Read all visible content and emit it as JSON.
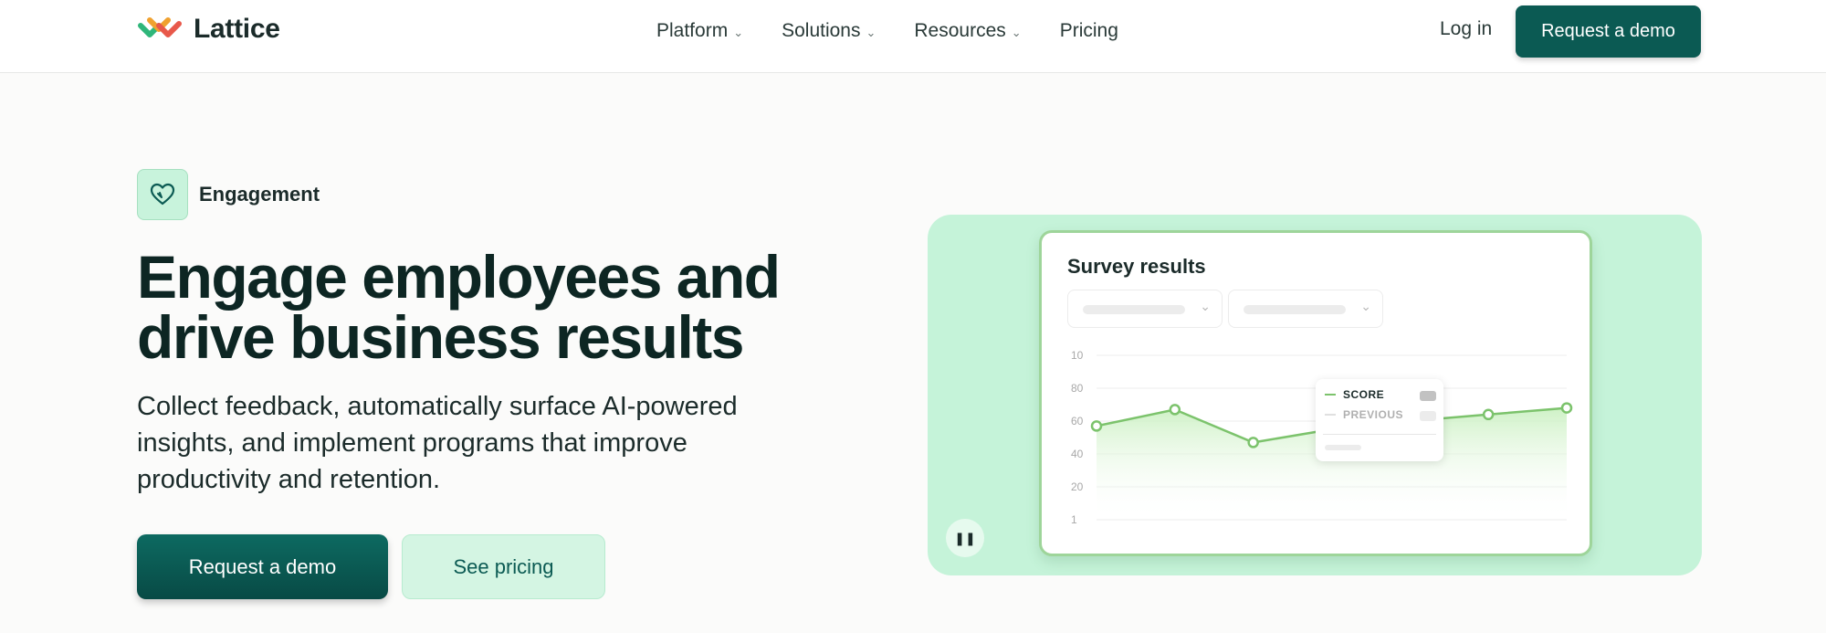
{
  "nav": {
    "brand": "Lattice",
    "links": [
      {
        "label": "Platform",
        "chevron": "⌄"
      },
      {
        "label": "Solutions",
        "chevron": "⌄"
      },
      {
        "label": "Resources",
        "chevron": "⌄"
      },
      {
        "label": "Pricing",
        "chevron": ""
      }
    ],
    "login": "Log in",
    "cta": "Request a demo"
  },
  "hero": {
    "badge": "Engagement",
    "title": "Engage employees and drive business results",
    "subtitle": "Collect feedback, automatically surface AI-powered insights, and implement programs that improve productivity and retention.",
    "primary_cta": "Request a demo",
    "secondary_cta": "See pricing"
  },
  "survey_card": {
    "title": "Survey results",
    "pause_glyph": "❚❚",
    "legend": [
      {
        "label": "SCORE",
        "color": "#7cc36c"
      },
      {
        "label": "PREVIOUS",
        "color": "#e0e0e0"
      }
    ],
    "dropdown_chevron": "⌄"
  },
  "colors": {
    "brand_dark": "#0b5a53",
    "mint": "#c5f3d9",
    "chart_green": "#7cc36c"
  },
  "chart_data": {
    "type": "line",
    "y_ticks": [
      "10",
      "80",
      "60",
      "40",
      "20",
      "1"
    ],
    "series": [
      {
        "name": "SCORE",
        "values": [
          57,
          67,
          47,
          55,
          60,
          64,
          68
        ],
        "marked": [
          true,
          true,
          true,
          false,
          false,
          true,
          true
        ]
      }
    ],
    "grid": true,
    "legend_position": "center-top"
  }
}
